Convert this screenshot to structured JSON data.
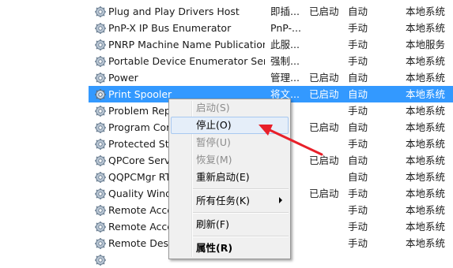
{
  "services": [
    {
      "name": "Plug and Play Drivers Host",
      "desc": "即插...",
      "status": "已启动",
      "startup": "自动",
      "logon": "本地系统"
    },
    {
      "name": "PnP-X IP Bus Enumerator",
      "desc": "PnP-...",
      "status": "",
      "startup": "手动",
      "logon": "本地系统"
    },
    {
      "name": "PNRP Machine Name Publication...",
      "desc": "此服...",
      "status": "",
      "startup": "手动",
      "logon": "本地服务"
    },
    {
      "name": "Portable Device Enumerator Ser...",
      "desc": "强制...",
      "status": "",
      "startup": "手动",
      "logon": "本地系统"
    },
    {
      "name": "Power",
      "desc": "管理...",
      "status": "已启动",
      "startup": "自动",
      "logon": "本地系统"
    },
    {
      "name": "Print Spooler",
      "desc": "将文...",
      "status": "已启动",
      "startup": "自动",
      "logon": "本地系统",
      "selected": true
    },
    {
      "name": "Problem Rep",
      "desc": "",
      "status": "",
      "startup": "手动",
      "logon": "本地系统"
    },
    {
      "name": "Program Cor",
      "desc": "",
      "status": "已启动",
      "startup": "自动",
      "logon": "本地系统"
    },
    {
      "name": "Protected Sto",
      "desc": "",
      "status": "",
      "startup": "手动",
      "logon": "本地系统"
    },
    {
      "name": "QPCore Serv",
      "desc": "",
      "status": "已启动",
      "startup": "自动",
      "logon": "本地系统"
    },
    {
      "name": "QQPCMgr RT",
      "desc": "",
      "status": "",
      "startup": "自动",
      "logon": "本地系统"
    },
    {
      "name": "Quality Wind",
      "desc": "",
      "status": "已启动",
      "startup": "手动",
      "logon": "本地系统"
    },
    {
      "name": "Remote Acce",
      "desc": "",
      "status": "",
      "startup": "手动",
      "logon": "本地系统"
    },
    {
      "name": "Remote Acce",
      "desc": "",
      "status": "",
      "startup": "手动",
      "logon": "本地系统"
    },
    {
      "name": "Remote Desk",
      "desc": "",
      "status": "",
      "startup": "手动",
      "logon": "本地系统"
    },
    {
      "name": "",
      "desc": "",
      "status": "",
      "startup": "",
      "logon": ""
    }
  ],
  "context_menu": {
    "start": "启动(S)",
    "stop": "停止(O)",
    "pause": "暂停(U)",
    "resume": "恢复(M)",
    "restart": "重新启动(E)",
    "all_tasks": "所有任务(K)",
    "refresh": "刷新(F)",
    "properties": "属性(R)"
  },
  "colors": {
    "selection": "#3399ff",
    "annotation_arrow": "#e8202a"
  }
}
